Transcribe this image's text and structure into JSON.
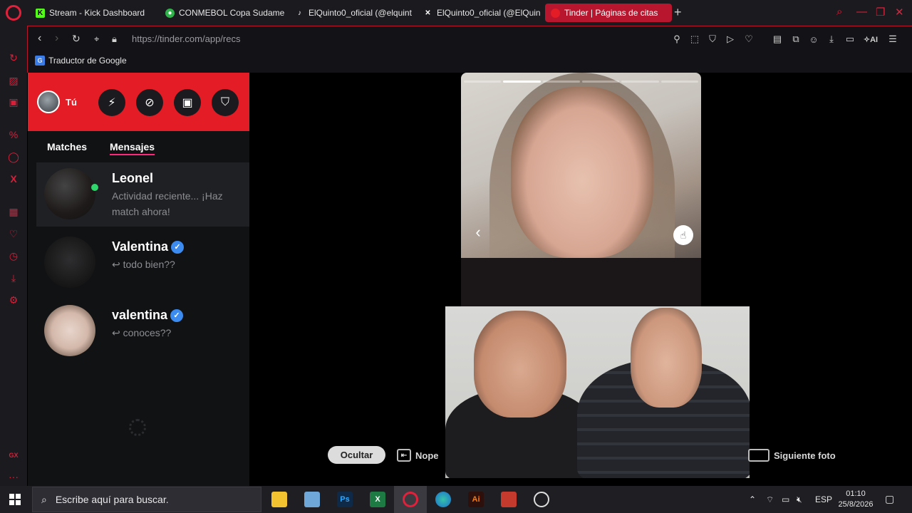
{
  "browser": {
    "tabs": [
      {
        "label": "Stream - Kick Dashboard",
        "icon": "kick-icon"
      },
      {
        "label": "CONMEBOL Copa Sudame",
        "icon": "conmebol-icon"
      },
      {
        "label": "ElQuinto0_oficial (@elquint",
        "icon": "tiktok-icon"
      },
      {
        "label": "ElQuinto0_oficial (@ElQuin",
        "icon": "x-icon"
      },
      {
        "label": "Tinder | Páginas de citas",
        "icon": "tinder-icon"
      }
    ],
    "url": "https://tinder.com/app/recs",
    "bookmark": "Traductor de Google"
  },
  "tinder": {
    "you_label": "Tú",
    "tabs": [
      "Matches",
      "Mensajes"
    ],
    "conversations": [
      {
        "name": "Leonel",
        "preview": "Actividad reciente... ¡Haz match ahora!",
        "verified": false,
        "online": true
      },
      {
        "name": "Valentina",
        "preview": "todo bien??",
        "verified": true,
        "online": false
      },
      {
        "name": "valentina",
        "preview": "conoces??",
        "verified": true,
        "online": false
      }
    ],
    "photo_segments": 6,
    "photo_active": 2
  },
  "hints": {
    "hide": "Ocultar",
    "nope": "Nope",
    "next_photo": "Siguiente foto"
  },
  "taskbar": {
    "search_placeholder": "Escribe aquí para buscar.",
    "lang": "ESP",
    "time": "01:10",
    "date": "25/8/2026"
  },
  "colors": {
    "tinder_red": "#e31c25",
    "opera_red": "#e0213b",
    "accent_pink": "#fd297b"
  }
}
